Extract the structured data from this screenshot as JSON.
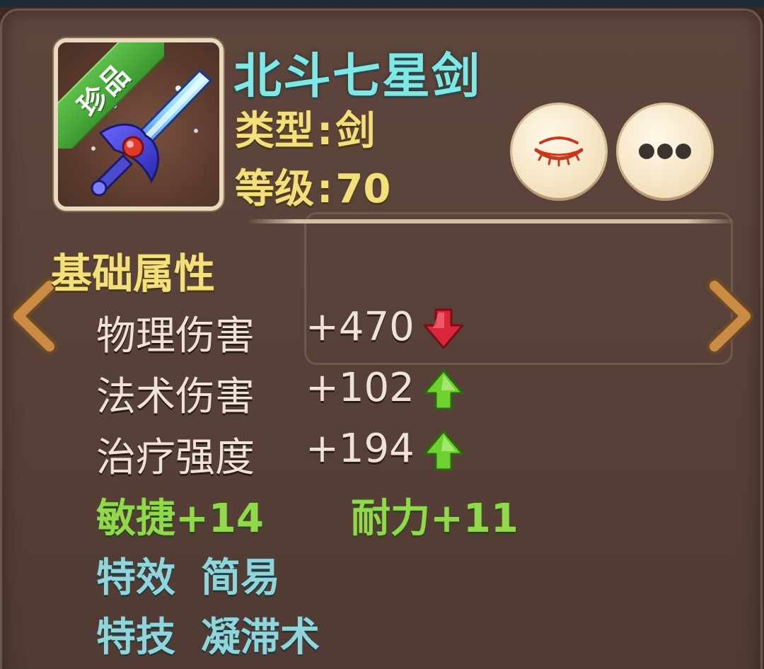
{
  "item": {
    "quality_badge": "珍品",
    "name": "北斗七星剑",
    "type_label": "类型",
    "type_value": "剑",
    "level_label": "等级",
    "level_value": "70",
    "icon": "sword-icon"
  },
  "buttons": {
    "hide": {
      "icon": "closed-eye-icon"
    },
    "more": {
      "icon": "ellipsis-icon"
    }
  },
  "section": {
    "title": "基础属性"
  },
  "base_stats": [
    {
      "name": "物理伤害",
      "value": "+470",
      "trend": "down",
      "trend_color": "#d8263a"
    },
    {
      "name": "法术伤害",
      "value": "+102",
      "trend": "up",
      "trend_color": "#6fd12e"
    },
    {
      "name": "治疗强度",
      "value": "+194",
      "trend": "up",
      "trend_color": "#6fd12e"
    }
  ],
  "bonus_stats": [
    {
      "text": "敏捷+14"
    },
    {
      "text": "耐力+11"
    }
  ],
  "specials": {
    "effect_label": "特效",
    "effect_value": "简易",
    "skill_label": "特技",
    "skill_value": "凝滞术"
  },
  "navigation": {
    "prev_icon": "chevron-left-icon",
    "next_icon": "chevron-right-icon"
  },
  "colors": {
    "title": "#7ee8e6",
    "label_yellow": "#f3e07a",
    "bonus_green": "#8fd94a",
    "special_cyan": "#8fd6dc",
    "badge_green": "#4aae3a"
  }
}
